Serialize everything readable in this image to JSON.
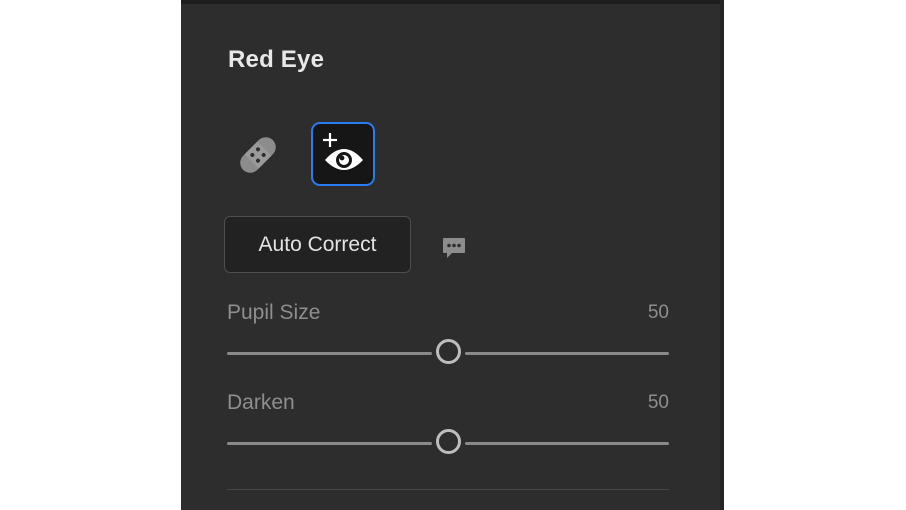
{
  "panel": {
    "title": "Red Eye"
  },
  "tools": [
    {
      "name": "healing-tool",
      "icon": "bandage-icon",
      "selected": false
    },
    {
      "name": "red-eye-tool",
      "icon": "eye-plus-icon",
      "selected": true
    }
  ],
  "auto_correct": {
    "label": "Auto Correct",
    "feedback_icon": "speech-bubble-icon"
  },
  "sliders": {
    "pupil_size": {
      "label": "Pupil Size",
      "value": "50",
      "fraction": 0.5
    },
    "darken": {
      "label": "Darken",
      "value": "50",
      "fraction": 0.5
    }
  },
  "colors": {
    "panel_bg": "#2d2d2d",
    "selected_border": "#2b7bf0"
  }
}
